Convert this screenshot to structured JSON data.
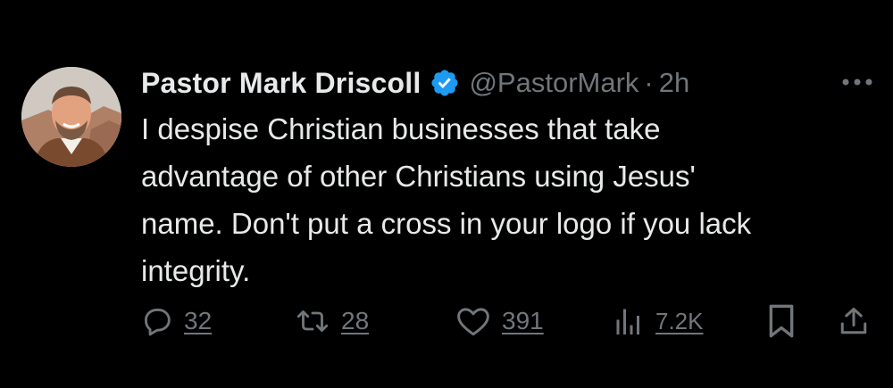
{
  "author": {
    "display_name": "Pastor Mark Driscoll",
    "handle": "@PastorMark",
    "separator": "·",
    "time": "2h",
    "verified": true,
    "verified_color": "#1d9bf0"
  },
  "tweet": {
    "text_lines": [
      "I despise Christian businesses that take",
      "advantage of other Christians using Jesus'",
      "name. Don't put a cross in your logo if you lack",
      "integrity."
    ]
  },
  "actions": {
    "replies": "32",
    "reposts": "28",
    "likes": "391",
    "views": "7.2K"
  },
  "icons": {
    "reply": "reply-icon",
    "repost": "repost-icon",
    "like": "like-icon",
    "views": "views-icon",
    "bookmark": "bookmark-icon",
    "share": "share-icon",
    "more": "more-icon"
  },
  "colors": {
    "background": "#000000",
    "text": "#e7e9ea",
    "muted": "#71767b",
    "accent": "#1d9bf0"
  }
}
